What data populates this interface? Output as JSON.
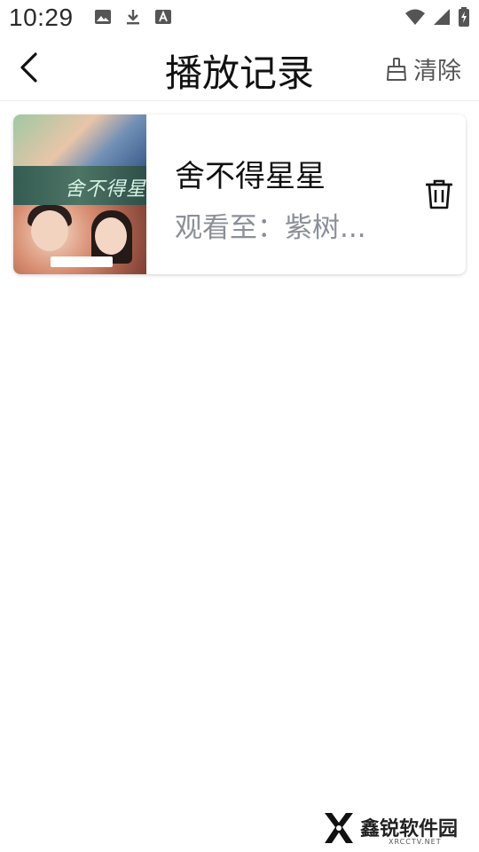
{
  "status_bar": {
    "time": "10:29",
    "left_icons": [
      "image-icon",
      "download-icon",
      "text-a-icon"
    ],
    "right_icons": [
      "wifi-icon",
      "cell-signal-icon",
      "battery-charging-icon"
    ]
  },
  "header": {
    "back_icon": "chevron-left-icon",
    "title": "播放记录",
    "clear_label": "清除",
    "clear_icon": "broom-icon"
  },
  "records": [
    {
      "title": "舍不得星星",
      "progress": "观看至：紫树...",
      "poster_caption": "舍不得星星",
      "delete_icon": "trash-icon"
    }
  ],
  "watermark": {
    "text": "鑫锐软件园",
    "sub": "XRCCTV.NET"
  },
  "colors": {
    "title_text": "#111111",
    "secondary_text": "#8a8f99",
    "divider": "#ececec"
  }
}
